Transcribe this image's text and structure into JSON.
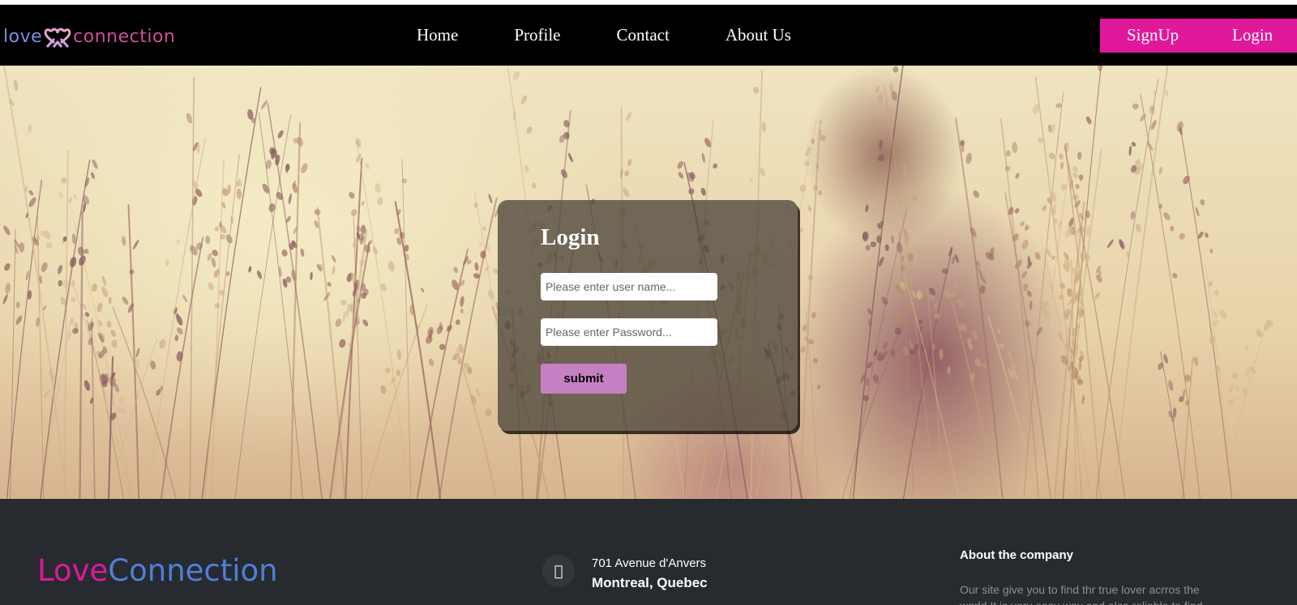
{
  "header": {
    "logo": {
      "part1": "love",
      "part2": "connection",
      "icon": "heart-couple-icon"
    },
    "nav": [
      "Home",
      "Profile",
      "Contact",
      "About Us"
    ],
    "signup_label": "SignUp",
    "login_label": "Login",
    "accent": "#e0189a"
  },
  "login": {
    "title": "Login",
    "username_placeholder": "Please enter user name...",
    "password_placeholder": "Please enter Password...",
    "submit_label": "submit",
    "submit_color": "#c77fc3"
  },
  "footer": {
    "brand_part1": "Love",
    "brand_part2": "Connection",
    "address_icon": "map-marker-icon",
    "address_line1": "701 Avenue d'Anvers",
    "address_line2": "Montreal, Quebec",
    "about_title": "About the company",
    "about_text": "Our site give you to find thr true lover acrros the world.It is very easy way and also reliable to find"
  }
}
